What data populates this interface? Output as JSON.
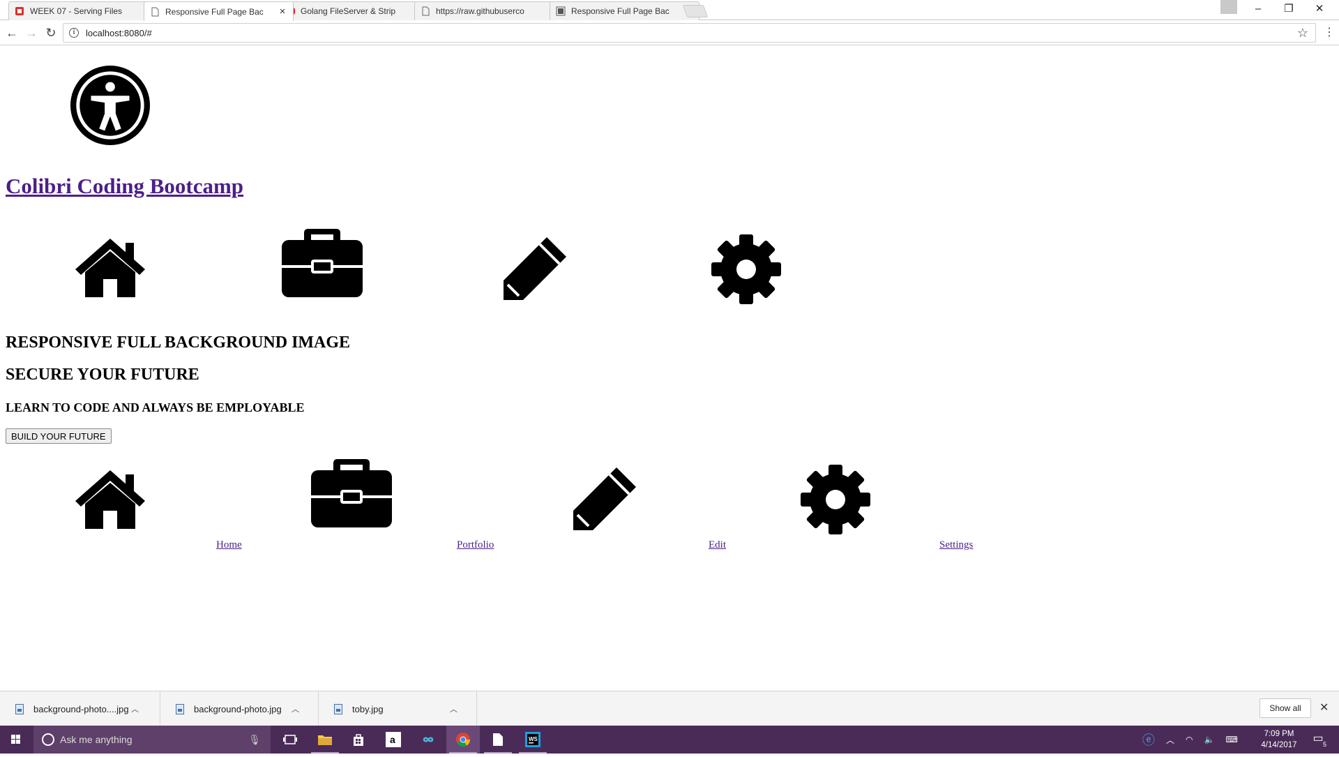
{
  "browser": {
    "tabs": [
      {
        "title": "WEEK 07 - Serving Files",
        "favicon_color": "#d9342b",
        "active": false
      },
      {
        "title": "Responsive Full Page Bac",
        "favicon_color": "#777777",
        "active": true
      },
      {
        "title": "Golang FileServer & Strip",
        "favicon_color": "#e62117",
        "active": false
      },
      {
        "title": "https://raw.githubuserco",
        "favicon_color": "#777777",
        "active": false
      },
      {
        "title": "Responsive Full Page Bac",
        "favicon_color": "#555555",
        "active": false
      }
    ],
    "url": "localhost:8080/#"
  },
  "page": {
    "brand": "Colibri Coding Bootcamp",
    "heading1": "RESPONSIVE FULL BACKGROUND IMAGE",
    "heading2": "SECURE YOUR FUTURE",
    "heading3": "LEARN TO CODE AND ALWAYS BE EMPLOYABLE",
    "cta_button": "BUILD YOUR FUTURE",
    "nav": [
      {
        "label": "Home",
        "icon": "home-icon"
      },
      {
        "label": "Portfolio",
        "icon": "briefcase-icon"
      },
      {
        "label": "Edit",
        "icon": "pencil-icon"
      },
      {
        "label": "Settings",
        "icon": "gear-icon"
      }
    ],
    "link_color": "#4b1f8a"
  },
  "downloads": {
    "items": [
      {
        "name": "background-photo....jpg"
      },
      {
        "name": "background-photo.jpg"
      },
      {
        "name": "toby.jpg"
      }
    ],
    "show_all": "Show all"
  },
  "taskbar": {
    "search_placeholder": "Ask me anything",
    "time": "7:09 PM",
    "date": "4/14/2017",
    "notification_count": "5",
    "color": "#4a2b57"
  }
}
